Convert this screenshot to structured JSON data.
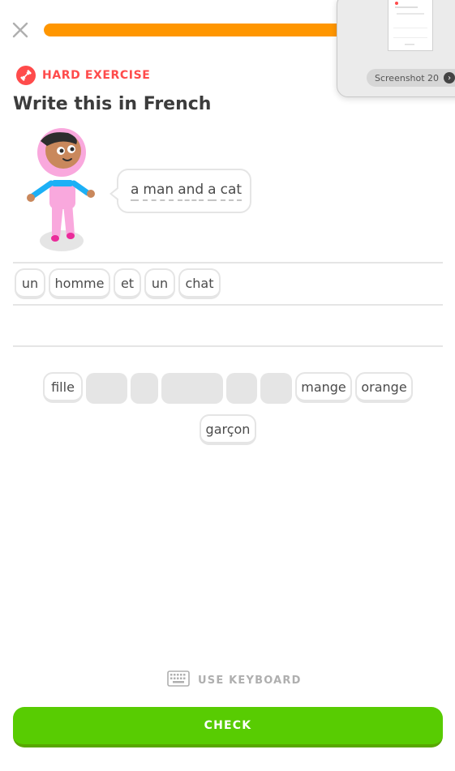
{
  "header": {
    "progress": 0.78
  },
  "badge": {
    "label": "HARD EXERCISE"
  },
  "prompt": {
    "title": "Write this in French",
    "sentence_words": [
      "a",
      "man",
      "and",
      "a",
      "cat"
    ]
  },
  "answer_chips": [
    "un",
    "homme",
    "et",
    "un",
    "chat"
  ],
  "bank": {
    "visible_words": [
      "fille",
      "mange",
      "orange",
      "garçon"
    ]
  },
  "footer": {
    "keyboard_label": "USE KEYBOARD",
    "check_label": "CHECK"
  },
  "screenshot_thumb": {
    "caption": "Screenshot 20"
  },
  "colors": {
    "accent_green": "#58cc02",
    "progress_orange": "#ff9600",
    "hard_red": "#ff4b4b"
  }
}
